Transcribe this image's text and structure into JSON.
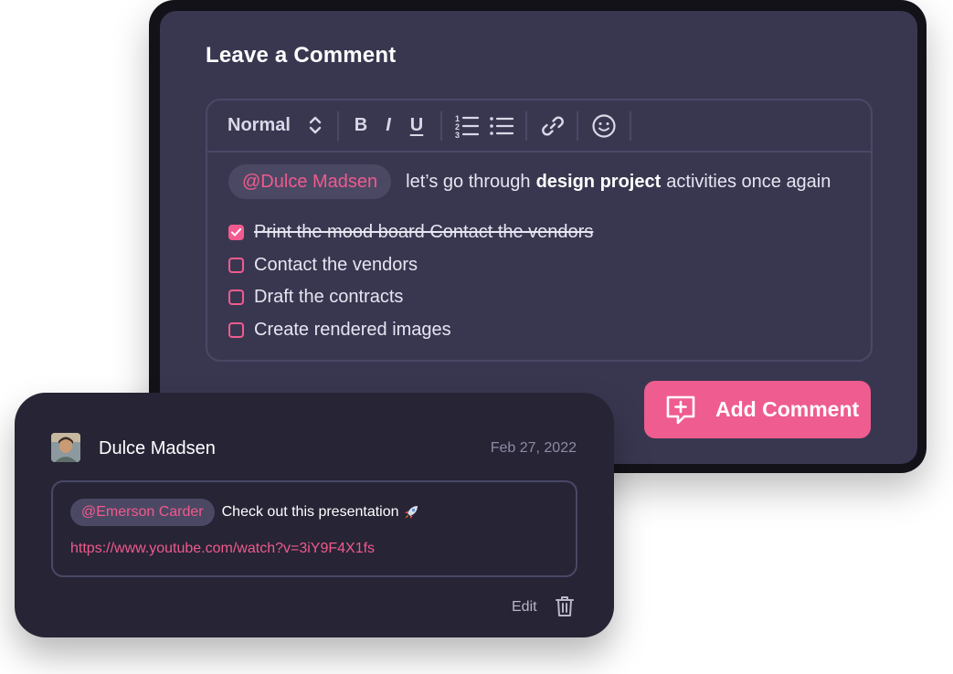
{
  "editor": {
    "title": "Leave a Comment",
    "toolbar": {
      "text_style": "Normal",
      "bold_label": "B",
      "italic_label": "I",
      "underline_label": "U"
    },
    "mention": "@Dulce Madsen",
    "message_before": "let’s go through",
    "message_bold": "design project",
    "message_after": "activities once again",
    "checklist": [
      {
        "label": "Print the mood board Contact the vendors",
        "checked": true
      },
      {
        "label": "Contact the vendors",
        "checked": false
      },
      {
        "label": "Draft the contracts",
        "checked": false
      },
      {
        "label": "Create rendered images",
        "checked": false
      }
    ],
    "submit_label": "Add Comment"
  },
  "comment": {
    "author": "Dulce Madsen",
    "date": "Feb 27, 2022",
    "mention": "@Emerson Carder",
    "text": "Check out this presentation",
    "link": "https://www.youtube.com/watch?v=3iY9F4X1fs",
    "edit_label": "Edit"
  },
  "colors": {
    "accent": "#ef5c8f",
    "editor_bg": "#393750",
    "comment_bg": "#262435",
    "border": "#4a4866",
    "pill_bg": "#4b4864"
  },
  "icons": [
    "chevron-updown-icon",
    "ordered-list-icon",
    "bullet-list-icon",
    "link-icon",
    "emoji-icon",
    "add-comment-icon",
    "rocket-icon",
    "trash-icon",
    "check-icon"
  ]
}
